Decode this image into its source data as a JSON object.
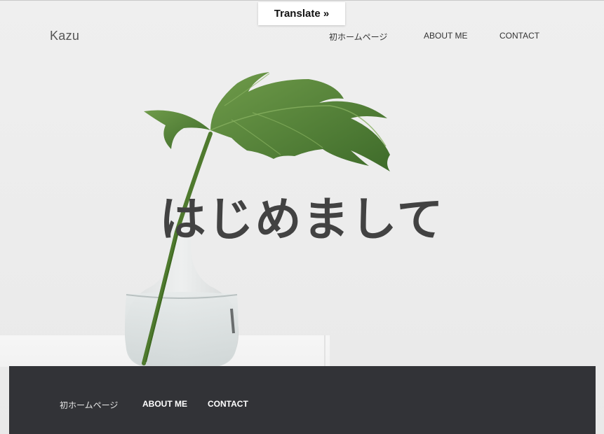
{
  "translate": {
    "label": "Translate »"
  },
  "header": {
    "brand": "Kazu",
    "nav": [
      {
        "label": "初ホームページ"
      },
      {
        "label": "ABOUT ME"
      },
      {
        "label": "CONTACT"
      }
    ]
  },
  "hero": {
    "title": "はじめまして"
  },
  "footer": {
    "nav": [
      {
        "label": "初ホームページ"
      },
      {
        "label": "ABOUT ME"
      },
      {
        "label": "CONTACT"
      }
    ]
  },
  "colors": {
    "background": "#eeeeee",
    "footer": "#323337",
    "title": "#424242",
    "leaf": "#5b8a3a"
  }
}
